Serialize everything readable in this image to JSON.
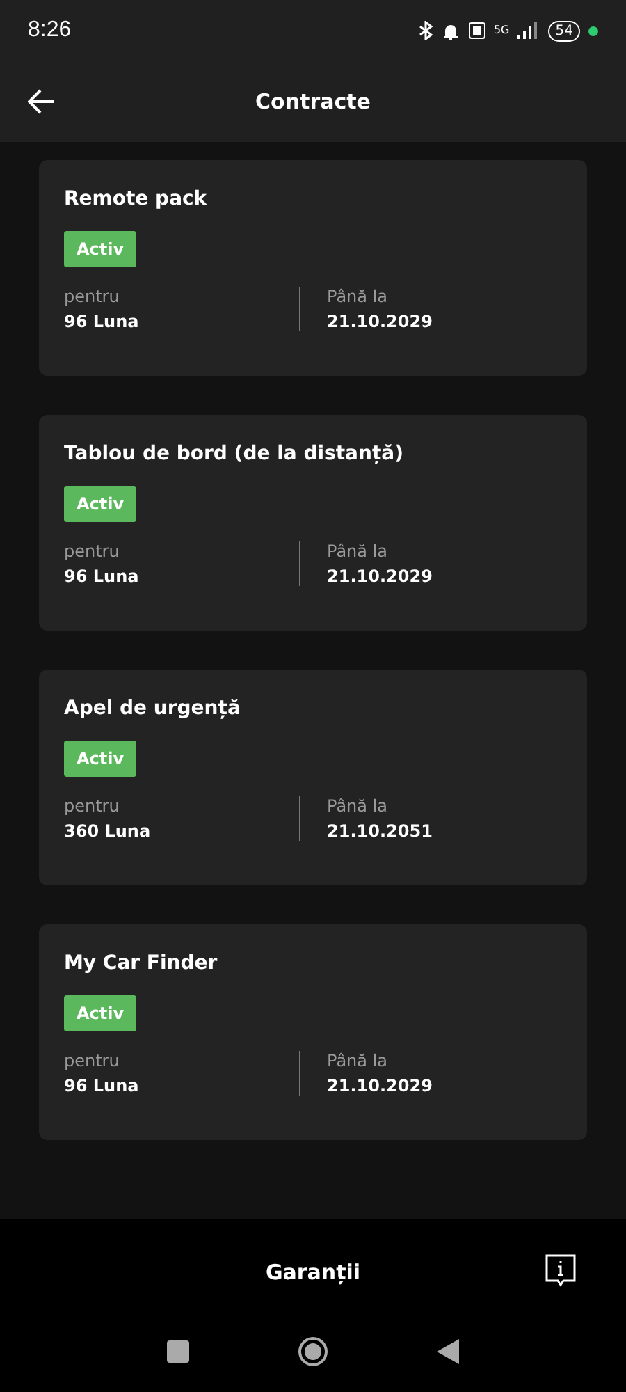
{
  "status_bar": {
    "time": "8:26",
    "network": "5G",
    "battery": "54"
  },
  "app_bar": {
    "title": "Contracte"
  },
  "contracts": [
    {
      "name": "Remote pack",
      "status": "Activ",
      "period_label": "pentru",
      "period": "96 Luna",
      "until_label": "Până la",
      "until": "21.10.2029"
    },
    {
      "name": "Tablou de bord (de la distanță)",
      "status": "Activ",
      "period_label": "pentru",
      "period": "96 Luna",
      "until_label": "Până la",
      "until": "21.10.2029"
    },
    {
      "name": "Apel de urgență",
      "status": "Activ",
      "period_label": "pentru",
      "period": "360 Luna",
      "until_label": "Până la",
      "until": "21.10.2051"
    },
    {
      "name": "My Car Finder",
      "status": "Activ",
      "period_label": "pentru",
      "period": "96 Luna",
      "until_label": "Până la",
      "until": "21.10.2029"
    }
  ],
  "bottom_bar": {
    "label": "Garanții"
  }
}
